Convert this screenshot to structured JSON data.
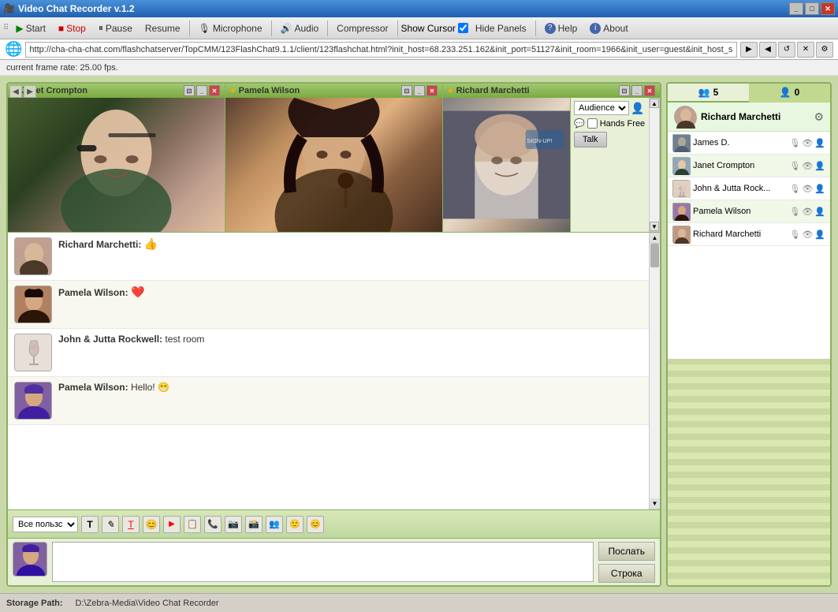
{
  "window": {
    "title": "Video Chat Recorder v.1.2",
    "icon": "🎥"
  },
  "toolbar": {
    "start": "Start",
    "stop": "Stop",
    "pause": "Pause",
    "resume": "Resume",
    "microphone": "Microphone",
    "audio": "Audio",
    "compressor": "Compressor",
    "show_cursor": "Show Cursor",
    "hide_panels": "Hide Panels",
    "help": "Help",
    "about": "About"
  },
  "address": {
    "url": "http://cha-cha-chat.com/flashchatserver/TopCMM/123FlashChat9.1.1/client/123flashchat.html?init_host=68.233.251.162&init_port=51127&init_room=1966&init_user=guest&init_host_s="
  },
  "status_top": {
    "text": "current frame rate: 25.00 fps."
  },
  "video_windows": [
    {
      "name": "Janet Crompton",
      "type": "janet"
    },
    {
      "name": "Pamela Wilson",
      "type": "pamela"
    },
    {
      "name": "Richard Marchetti",
      "type": "richard"
    }
  ],
  "audience_panel": {
    "dropdown_label": "Audience",
    "hands_free": "Hands Free",
    "talk_btn": "Talk"
  },
  "messages": [
    {
      "sender": "Richard Marchetti:",
      "text": "👍",
      "avatar_type": "richard"
    },
    {
      "sender": "Pamela Wilson:",
      "text": "❤️",
      "avatar_type": "pamela"
    },
    {
      "sender": "John & Jutta Rockwell:",
      "text": "test room",
      "avatar_type": "john"
    },
    {
      "sender": "Pamela Wilson:",
      "text": "Hello! 😁",
      "avatar_type": "pamela2"
    }
  ],
  "chat_toolbar": {
    "group_label": "Все пользс",
    "icons": [
      "T",
      "✏",
      "T",
      "😊",
      "▶",
      "📋",
      "📞",
      "📷",
      "📷",
      "👤",
      "🙂",
      "😊"
    ]
  },
  "input_buttons": {
    "send": "Послать",
    "line": "Строка"
  },
  "right_panel": {
    "tab1_icon": "👥",
    "tab1_count": "5",
    "tab2_icon": "👤",
    "tab2_count": "0",
    "me": {
      "name": "Richard Marchetti"
    },
    "participants": [
      {
        "name": "James D.",
        "type": "james"
      },
      {
        "name": "Janet Crompton",
        "type": "janet"
      },
      {
        "name": "John & Jutta Rock...",
        "type": "john"
      },
      {
        "name": "Pamela Wilson",
        "type": "pamela"
      },
      {
        "name": "Richard Marchetti",
        "type": "richard"
      }
    ]
  },
  "status_bar": {
    "label": "Storage Path:",
    "path": "D:\\Zebra-Media\\Video Chat Recorder"
  }
}
